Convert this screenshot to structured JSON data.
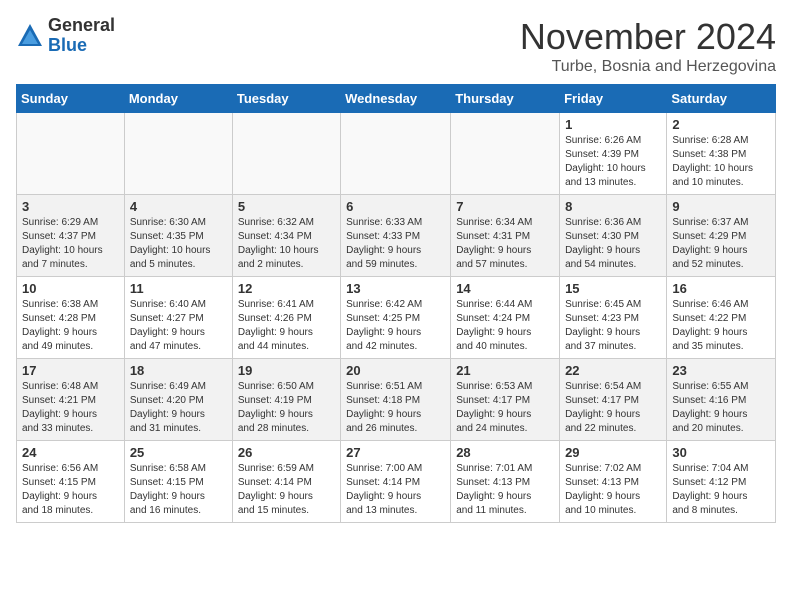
{
  "logo": {
    "general": "General",
    "blue": "Blue"
  },
  "title": "November 2024",
  "subtitle": "Turbe, Bosnia and Herzegovina",
  "weekdays": [
    "Sunday",
    "Monday",
    "Tuesday",
    "Wednesday",
    "Thursday",
    "Friday",
    "Saturday"
  ],
  "weeks": [
    [
      {
        "day": "",
        "info": ""
      },
      {
        "day": "",
        "info": ""
      },
      {
        "day": "",
        "info": ""
      },
      {
        "day": "",
        "info": ""
      },
      {
        "day": "",
        "info": ""
      },
      {
        "day": "1",
        "info": "Sunrise: 6:26 AM\nSunset: 4:39 PM\nDaylight: 10 hours\nand 13 minutes."
      },
      {
        "day": "2",
        "info": "Sunrise: 6:28 AM\nSunset: 4:38 PM\nDaylight: 10 hours\nand 10 minutes."
      }
    ],
    [
      {
        "day": "3",
        "info": "Sunrise: 6:29 AM\nSunset: 4:37 PM\nDaylight: 10 hours\nand 7 minutes."
      },
      {
        "day": "4",
        "info": "Sunrise: 6:30 AM\nSunset: 4:35 PM\nDaylight: 10 hours\nand 5 minutes."
      },
      {
        "day": "5",
        "info": "Sunrise: 6:32 AM\nSunset: 4:34 PM\nDaylight: 10 hours\nand 2 minutes."
      },
      {
        "day": "6",
        "info": "Sunrise: 6:33 AM\nSunset: 4:33 PM\nDaylight: 9 hours\nand 59 minutes."
      },
      {
        "day": "7",
        "info": "Sunrise: 6:34 AM\nSunset: 4:31 PM\nDaylight: 9 hours\nand 57 minutes."
      },
      {
        "day": "8",
        "info": "Sunrise: 6:36 AM\nSunset: 4:30 PM\nDaylight: 9 hours\nand 54 minutes."
      },
      {
        "day": "9",
        "info": "Sunrise: 6:37 AM\nSunset: 4:29 PM\nDaylight: 9 hours\nand 52 minutes."
      }
    ],
    [
      {
        "day": "10",
        "info": "Sunrise: 6:38 AM\nSunset: 4:28 PM\nDaylight: 9 hours\nand 49 minutes."
      },
      {
        "day": "11",
        "info": "Sunrise: 6:40 AM\nSunset: 4:27 PM\nDaylight: 9 hours\nand 47 minutes."
      },
      {
        "day": "12",
        "info": "Sunrise: 6:41 AM\nSunset: 4:26 PM\nDaylight: 9 hours\nand 44 minutes."
      },
      {
        "day": "13",
        "info": "Sunrise: 6:42 AM\nSunset: 4:25 PM\nDaylight: 9 hours\nand 42 minutes."
      },
      {
        "day": "14",
        "info": "Sunrise: 6:44 AM\nSunset: 4:24 PM\nDaylight: 9 hours\nand 40 minutes."
      },
      {
        "day": "15",
        "info": "Sunrise: 6:45 AM\nSunset: 4:23 PM\nDaylight: 9 hours\nand 37 minutes."
      },
      {
        "day": "16",
        "info": "Sunrise: 6:46 AM\nSunset: 4:22 PM\nDaylight: 9 hours\nand 35 minutes."
      }
    ],
    [
      {
        "day": "17",
        "info": "Sunrise: 6:48 AM\nSunset: 4:21 PM\nDaylight: 9 hours\nand 33 minutes."
      },
      {
        "day": "18",
        "info": "Sunrise: 6:49 AM\nSunset: 4:20 PM\nDaylight: 9 hours\nand 31 minutes."
      },
      {
        "day": "19",
        "info": "Sunrise: 6:50 AM\nSunset: 4:19 PM\nDaylight: 9 hours\nand 28 minutes."
      },
      {
        "day": "20",
        "info": "Sunrise: 6:51 AM\nSunset: 4:18 PM\nDaylight: 9 hours\nand 26 minutes."
      },
      {
        "day": "21",
        "info": "Sunrise: 6:53 AM\nSunset: 4:17 PM\nDaylight: 9 hours\nand 24 minutes."
      },
      {
        "day": "22",
        "info": "Sunrise: 6:54 AM\nSunset: 4:17 PM\nDaylight: 9 hours\nand 22 minutes."
      },
      {
        "day": "23",
        "info": "Sunrise: 6:55 AM\nSunset: 4:16 PM\nDaylight: 9 hours\nand 20 minutes."
      }
    ],
    [
      {
        "day": "24",
        "info": "Sunrise: 6:56 AM\nSunset: 4:15 PM\nDaylight: 9 hours\nand 18 minutes."
      },
      {
        "day": "25",
        "info": "Sunrise: 6:58 AM\nSunset: 4:15 PM\nDaylight: 9 hours\nand 16 minutes."
      },
      {
        "day": "26",
        "info": "Sunrise: 6:59 AM\nSunset: 4:14 PM\nDaylight: 9 hours\nand 15 minutes."
      },
      {
        "day": "27",
        "info": "Sunrise: 7:00 AM\nSunset: 4:14 PM\nDaylight: 9 hours\nand 13 minutes."
      },
      {
        "day": "28",
        "info": "Sunrise: 7:01 AM\nSunset: 4:13 PM\nDaylight: 9 hours\nand 11 minutes."
      },
      {
        "day": "29",
        "info": "Sunrise: 7:02 AM\nSunset: 4:13 PM\nDaylight: 9 hours\nand 10 minutes."
      },
      {
        "day": "30",
        "info": "Sunrise: 7:04 AM\nSunset: 4:12 PM\nDaylight: 9 hours\nand 8 minutes."
      }
    ]
  ]
}
